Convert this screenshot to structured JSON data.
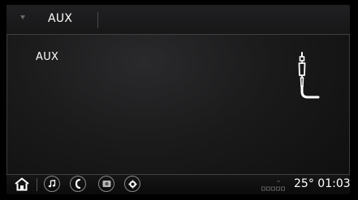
{
  "header": {
    "title": "AUX"
  },
  "source": {
    "label": "AUX"
  },
  "icons": {
    "menu_arrow": "triangle-down-icon",
    "aux_cable": "aux-cable-icon",
    "home": "home-icon",
    "media": "music-note-icon",
    "phone": "phone-icon",
    "camera": "camera-icon",
    "settings": "gear-icon",
    "signal": "signal-strength-icon"
  },
  "status": {
    "temperature": "25°",
    "time": "01:03"
  },
  "colors": {
    "background": "#1a1a1b",
    "text": "#ffffff",
    "icon_outline": "#8a8a8a"
  }
}
